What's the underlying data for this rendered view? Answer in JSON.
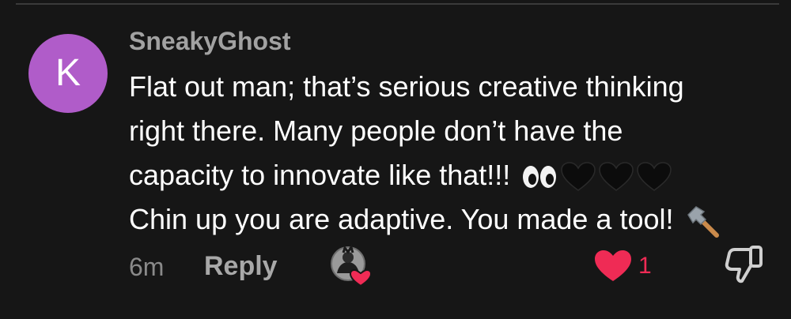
{
  "comment": {
    "avatar_letter": "K",
    "avatar_color": "#b05cc9",
    "username": "SneakyGhost",
    "lines": [
      "Flat out man; that’s serious creative thinking",
      "right there. Many people don’t have the",
      "capacity to innovate like that!!!",
      "Chin up you are adaptive. You made a tool!"
    ],
    "emojis": {
      "line3": [
        "eyes-icon",
        "black-heart-icon",
        "black-heart-icon",
        "black-heart-icon"
      ],
      "line4": [
        "hammer-icon"
      ]
    }
  },
  "footer": {
    "timestamp": "6m",
    "reply_label": "Reply",
    "like_count": "1",
    "like_color": "#ef2b55"
  }
}
